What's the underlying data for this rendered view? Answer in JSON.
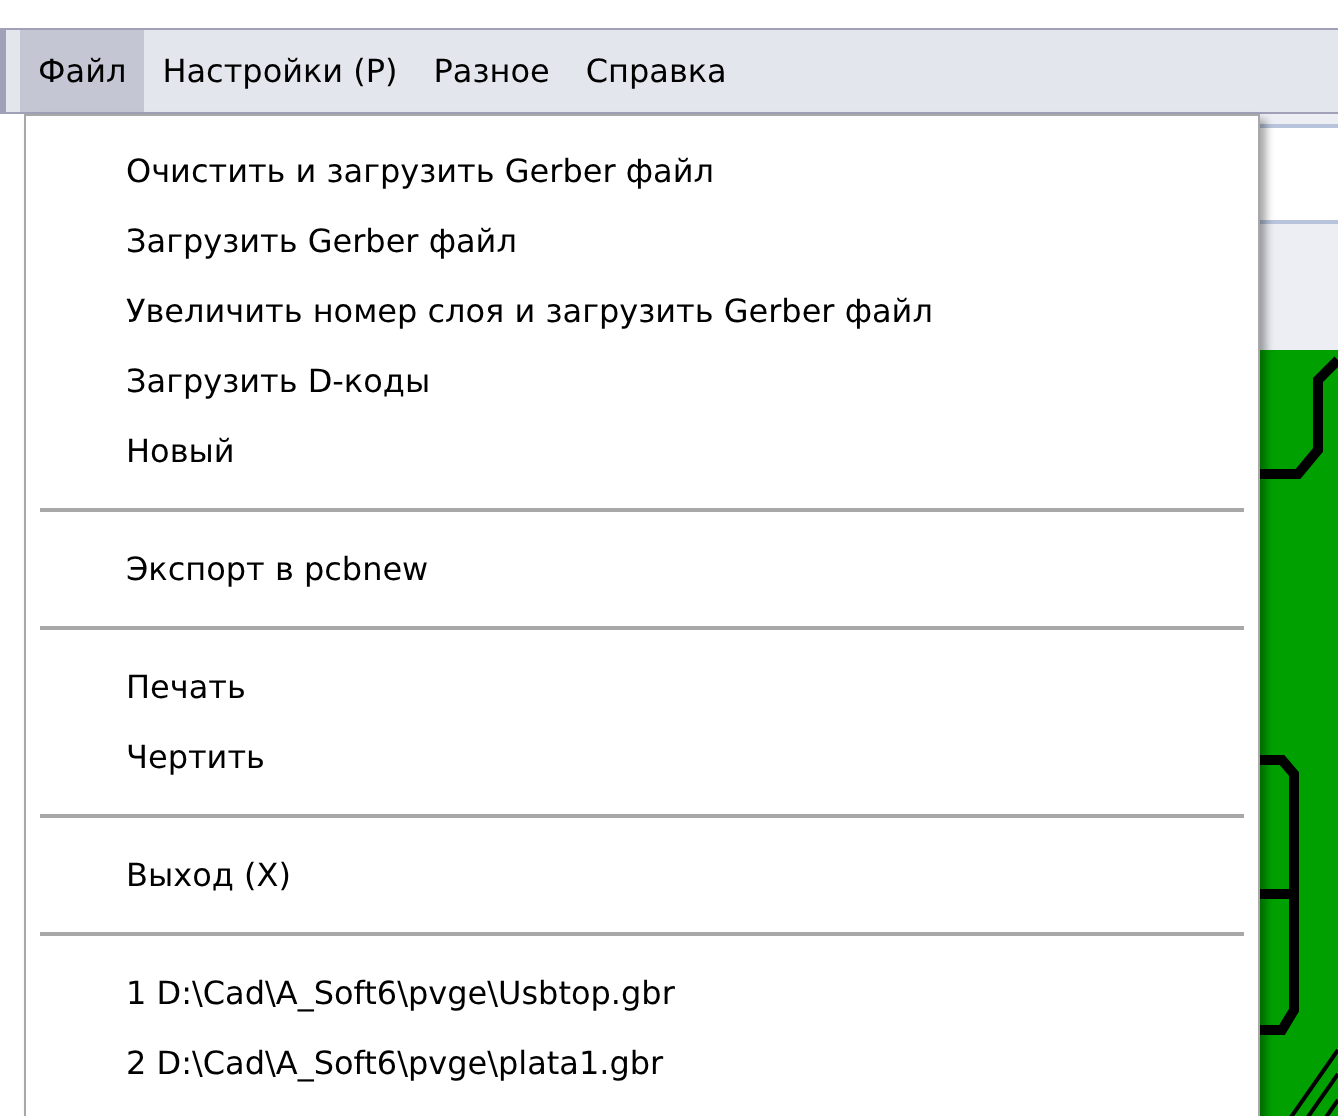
{
  "menu_bar": [
    {
      "label": "Файл",
      "selected": true
    },
    {
      "label": "Настройки (P)",
      "selected": false
    },
    {
      "label": "Разное",
      "selected": false
    },
    {
      "label": "Справка",
      "selected": false
    }
  ],
  "file_menu": [
    {
      "kind": "item",
      "label": "Очистить и загрузить Gerber файл"
    },
    {
      "kind": "item",
      "label": "Загрузить Gerber файл"
    },
    {
      "kind": "item",
      "label": "Увеличить номер слоя и загрузить Gerber файл"
    },
    {
      "kind": "item",
      "label": "Загрузить D-коды"
    },
    {
      "kind": "item",
      "label": "Новый"
    },
    {
      "kind": "separator"
    },
    {
      "kind": "item",
      "label": "Экспорт в pcbnew"
    },
    {
      "kind": "separator"
    },
    {
      "kind": "item",
      "label": "Печать"
    },
    {
      "kind": "item",
      "label": "Чертить"
    },
    {
      "kind": "separator"
    },
    {
      "kind": "item",
      "label": "Выход (X)"
    },
    {
      "kind": "separator"
    },
    {
      "kind": "item",
      "label": "1 D:\\Cad\\A_Soft6\\pvge\\Usbtop.gbr"
    },
    {
      "kind": "item",
      "label": "2 D:\\Cad\\A_Soft6\\pvge\\plata1.gbr"
    }
  ]
}
